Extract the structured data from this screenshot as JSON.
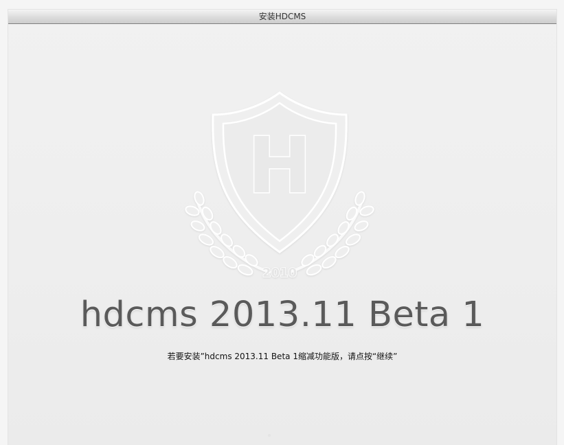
{
  "window": {
    "title": "安装HDCMS"
  },
  "logo": {
    "icon": "shield-laurel-logo-icon",
    "letter": "H",
    "year": "2010"
  },
  "main": {
    "headline": "hdcms 2013.11 Beta 1",
    "instruction": "若要安装”hdcms 2013.11 Beta 1缩减功能版，请点按“继续”"
  },
  "colors": {
    "background": "#efefef",
    "headline": "#5a5a5a",
    "titlebar_border": "#7d7d7d"
  }
}
